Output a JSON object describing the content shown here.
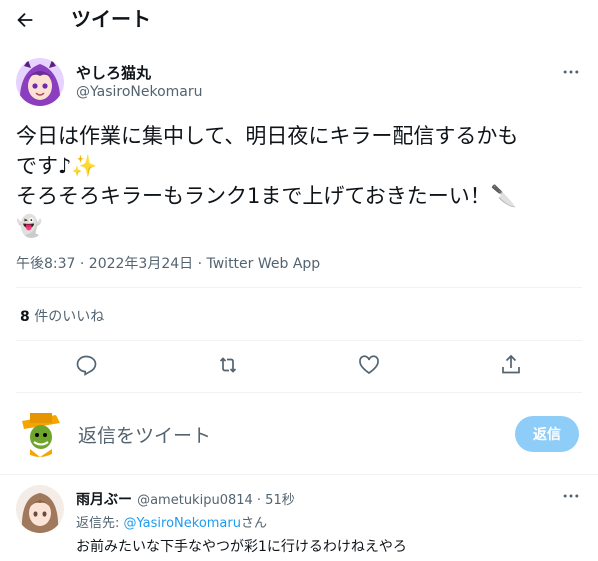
{
  "header": {
    "title": "ツイート"
  },
  "tweet": {
    "author_name": "やしろ猫丸",
    "author_handle": "@YasiroNekomaru",
    "text": "今日は作業に集中して、明日夜にキラー配信するかも\nです♪✨\nそろそろキラーもランク1まで上げておきたーい！🔪\n👻",
    "timestamp": "午後8:37 · 2022年3月24日 · Twitter Web App",
    "likes_count": "8",
    "likes_label": " 件のいいね"
  },
  "composer": {
    "placeholder": "返信をツイート",
    "reply_button": "返信"
  },
  "reply": {
    "author_name": "雨月ぶー",
    "author_handle": "@ametukipu0814",
    "time": " · 51秒",
    "replying_to_label": "返信先: ",
    "replying_to_handle": "@YasiroNekomaru",
    "replying_to_suffix": "さん",
    "text": "お前みたいな下手なやつが彩1に行けるわけねえやろ"
  },
  "icons": {
    "back": "arrow-left-icon",
    "more": "more-horizontal-icon",
    "reply": "reply-icon",
    "retweet": "retweet-icon",
    "like": "heart-icon",
    "share": "share-icon"
  },
  "colors": {
    "accent": "#1d9bf0",
    "reply_button_disabled": "#8ecdf7",
    "secondary_text": "#536471",
    "divider": "#eff3f4"
  }
}
